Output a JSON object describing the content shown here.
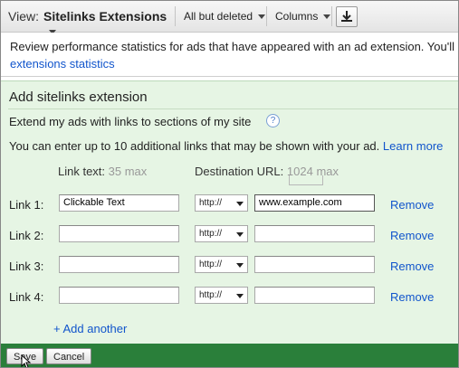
{
  "toolbar": {
    "view_label": "View:",
    "view_value": "Sitelinks Extensions",
    "filter_label": "All but deleted",
    "columns_label": "Columns",
    "download_icon": "download-icon"
  },
  "info": {
    "text": "Review performance statistics for ads that have appeared with an ad extension. You'll e",
    "link": "extensions statistics"
  },
  "panel": {
    "title": "Add sitelinks extension",
    "subtitle": "Extend my ads with links to sections of my site",
    "help_icon_label": "?",
    "limit_text": "You can enter up to 10 additional links that may be shown with your ad.",
    "learn_more": "Learn more",
    "link_text_header": "Link text:",
    "link_text_max": "35 max",
    "dest_url_header": "Destination URL:",
    "dest_url_max": "1024 max",
    "rows": [
      {
        "label": "Link 1:",
        "text": "Clickable Text",
        "protocol": "http://",
        "url": "www.example.com",
        "remove": "Remove"
      },
      {
        "label": "Link 2:",
        "text": "",
        "protocol": "http://",
        "url": "",
        "remove": "Remove"
      },
      {
        "label": "Link 3:",
        "text": "",
        "protocol": "http://",
        "url": "",
        "remove": "Remove"
      },
      {
        "label": "Link 4:",
        "text": "",
        "protocol": "http://",
        "url": "",
        "remove": "Remove"
      }
    ],
    "add_another": "+ Add another"
  },
  "footer": {
    "save": "Save",
    "cancel": "Cancel"
  },
  "colors": {
    "panel_bg": "#e6f5e4",
    "footer_bg": "#2a7f3a",
    "link": "#1155cc"
  }
}
